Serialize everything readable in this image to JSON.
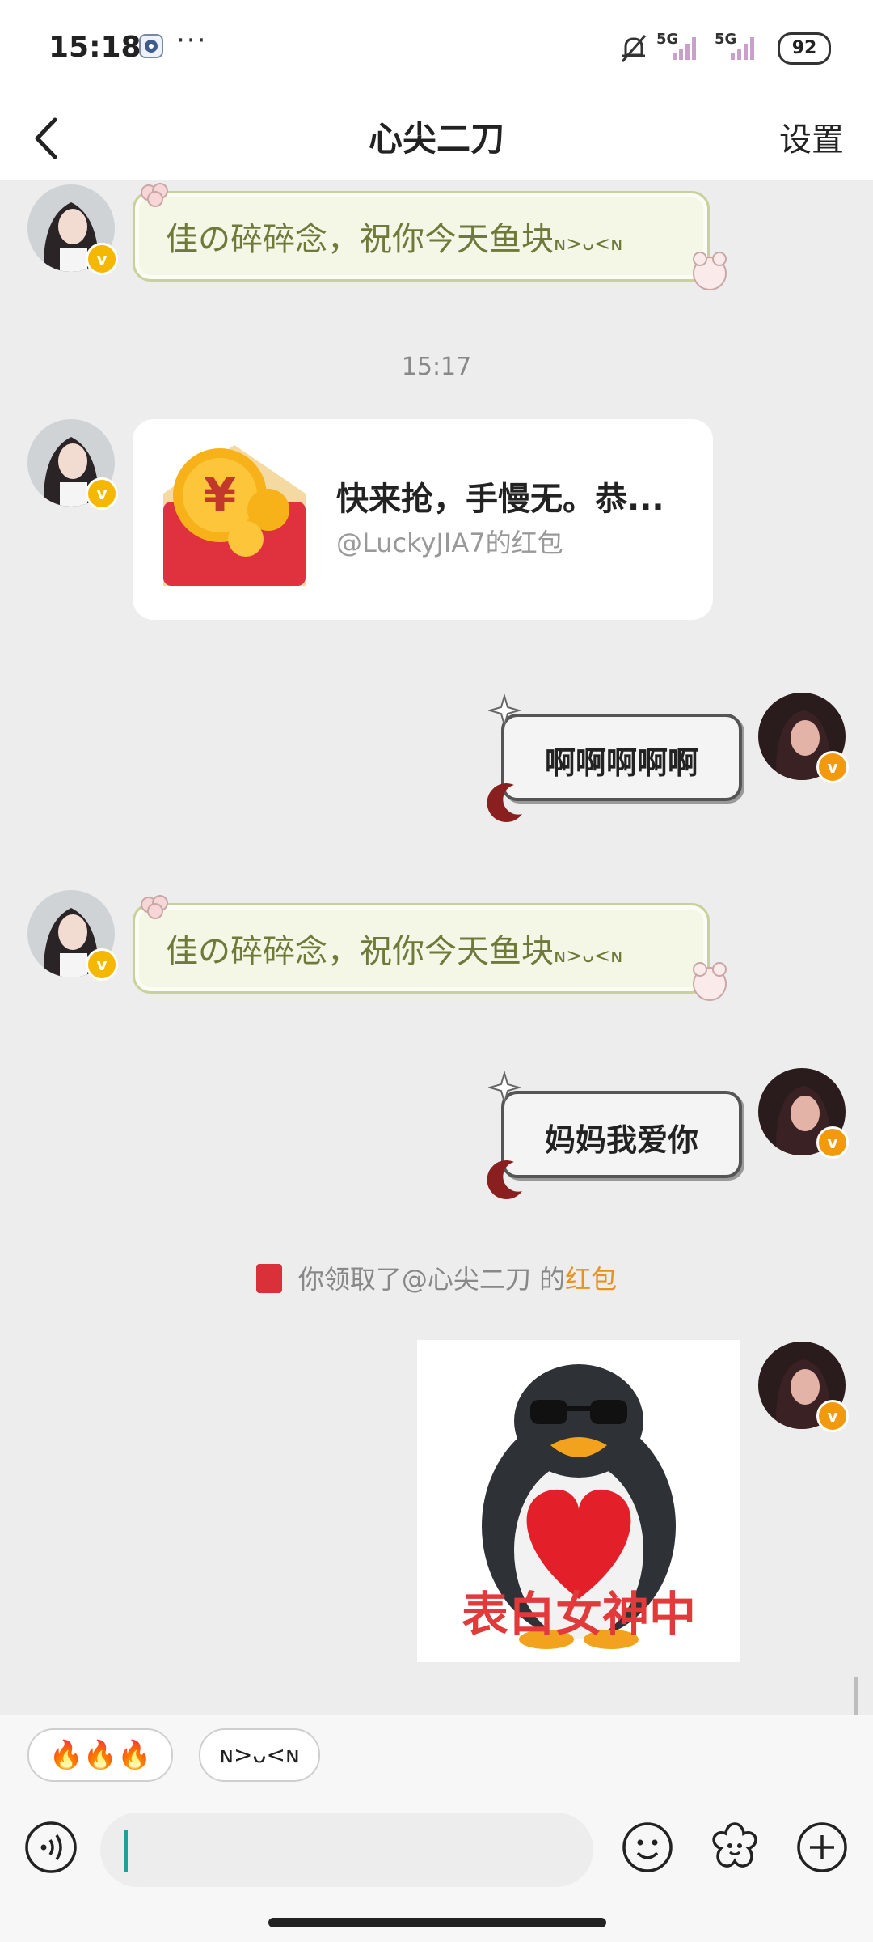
{
  "status_bar": {
    "time": "15:18",
    "more": "···",
    "signal1": "5G",
    "signal2": "5G",
    "battery": "92"
  },
  "nav": {
    "title": "心尖二刀",
    "settings": "设置"
  },
  "messages": {
    "m1_text": "佳の碎碎念，祝你今天鱼块",
    "m1_kaomoji": "ɴ>ᴗ<ɴ",
    "timestamp": "15:17",
    "red_packet_title": "快来抢，手慢无。恭...",
    "red_packet_sub": "@LuckyJIA7的红包",
    "m3_text": "啊啊啊啊啊",
    "m4_text": "佳の碎碎念，祝你今天鱼块",
    "m4_kaomoji": "ɴ>ᴗ<ɴ",
    "m5_text": "妈妈我爱你",
    "system_prefix": "你领取了@心尖二刀 的",
    "system_highlight": "红包",
    "sticker_text": "表白女神中"
  },
  "quick_replies": [
    "🔥🔥🔥",
    "ɴ>ᴗ<ɴ"
  ],
  "input": {
    "value": ""
  },
  "colors": {
    "green_bubble_text": "#6f7a3a",
    "green_bubble_border": "#c9d19a",
    "red_packet": "#e0313f",
    "highlight": "#e8921b",
    "cursor": "#1aa39a",
    "verified_badge": "#f5b800"
  },
  "icons": [
    "back-arrow-icon",
    "bell-off-icon",
    "voice-icon",
    "emoji-icon",
    "sticker-flower-icon",
    "plus-icon"
  ]
}
